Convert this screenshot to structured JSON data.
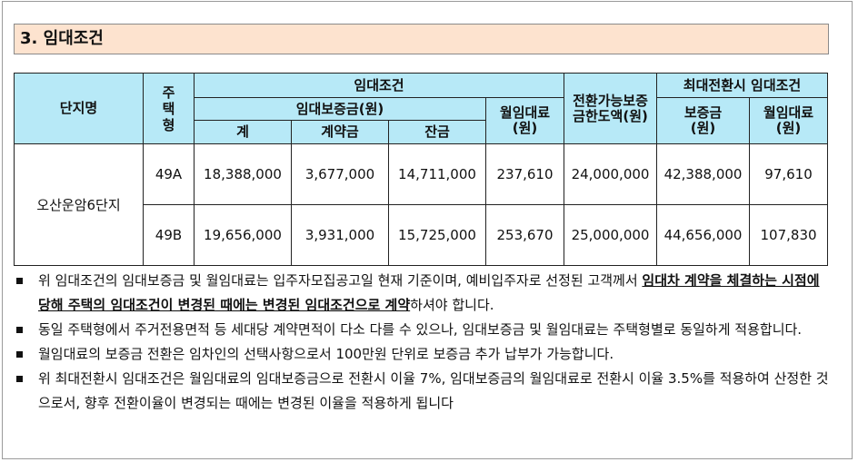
{
  "section": {
    "title": "3. 임대조건"
  },
  "table": {
    "h_complex": "단지명",
    "h_type": "주택형",
    "h_rent_cond": "임대조건",
    "h_deposit": "임대보증금(원)",
    "h_total": "계",
    "h_contract": "계약금",
    "h_balance": "잔금",
    "h_monthly": "월임대료(원)",
    "h_convertible": "전환가능보증금한도액(원)",
    "h_max_conv": "최대전환시 임대조건",
    "h_max_deposit": "보증금(원)",
    "h_max_monthly": "월임대료(원)",
    "complex_name": "오산운암6단지",
    "rows": [
      {
        "type": "49A",
        "total": "18,388,000",
        "contract": "3,677,000",
        "balance": "14,711,000",
        "monthly": "237,610",
        "convertible": "24,000,000",
        "max_deposit": "42,388,000",
        "max_monthly": "97,610"
      },
      {
        "type": "49B",
        "total": "19,656,000",
        "contract": "3,931,000",
        "balance": "15,725,000",
        "monthly": "253,670",
        "convertible": "25,000,000",
        "max_deposit": "44,656,000",
        "max_monthly": "107,830"
      }
    ]
  },
  "notes": {
    "n1_a": "위 임대조건의 임대보증금 및 월임대료는 입주자모집공고일 현재 기준이며, 예비입주자로 선정된 고객께서 ",
    "n1_b": "임대차 계약을 체결하는 시점에 당해 주택의 임대조건이 변경된 때에는 변경된 임대조건으로 계약",
    "n1_c": "하셔야 합니다.",
    "n2": "동일 주택형에서 주거전용면적 등 세대당 계약면적이 다소 다를 수 있으나, 임대보증금 및 월임대료는 주택형별로 동일하게 적용합니다.",
    "n3": "월임대료의 보증금 전환은 임차인의 선택사항으로서 100만원 단위로 보증금 추가 납부가 가능합니다.",
    "n4": "위 최대전환시 임대조건은 월임대료의 임대보증금으로 전환시 이율 7%, 임대보증금의 월임대료로 전환시 이율 3.5%를 적용하여 산정한 것으로서, 향후 전환이율이 변경되는 때에는 변경된 이율을 적용하게 됩니다"
  }
}
